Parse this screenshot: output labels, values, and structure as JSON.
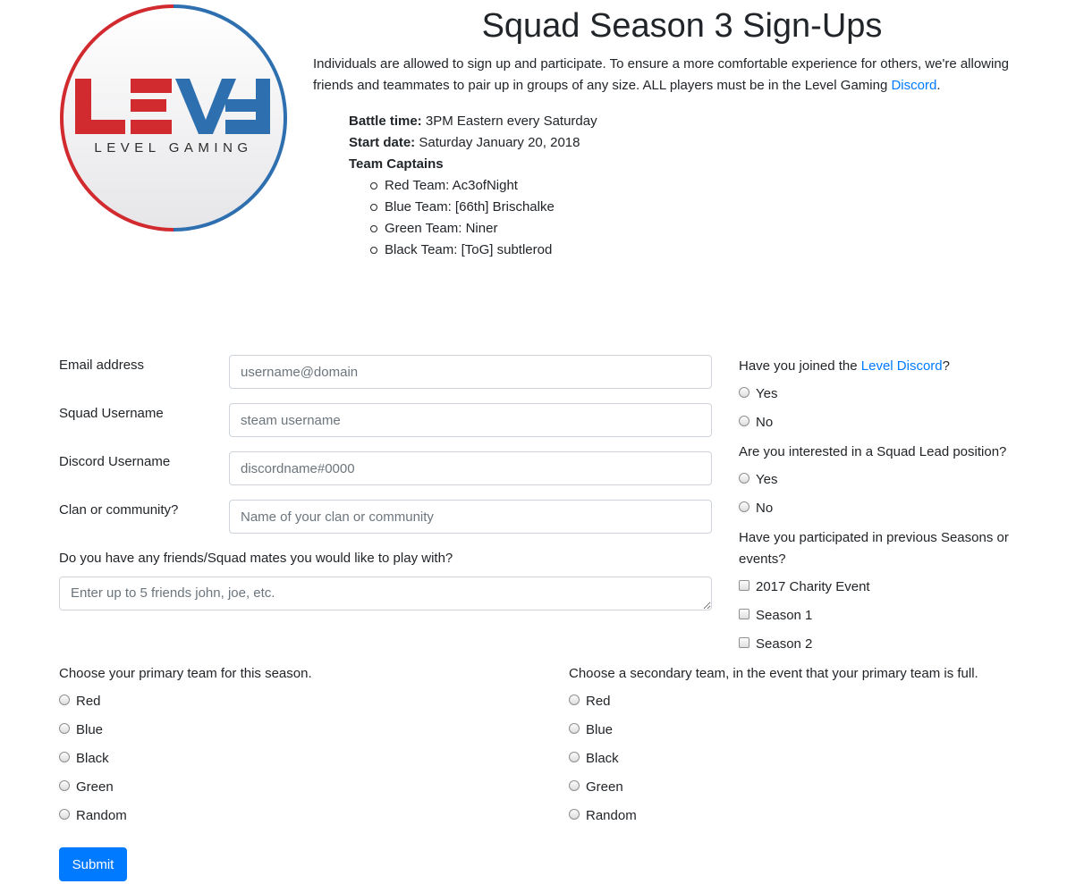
{
  "header": {
    "title": "Squad Season 3 Sign-Ups",
    "logo_text": "LEVEL GAMING",
    "intro_text": "Individuals are allowed to sign up and participate. To ensure a more comfortable experience for others, we're allowing friends and teammates to pair up in groups of any size. ALL players must be in the Level Gaming ",
    "intro_link": "Discord",
    "intro_end": "."
  },
  "details": {
    "battle_time_label": "Battle time:",
    "battle_time_value": " 3PM Eastern every Saturday",
    "start_date_label": "Start date:",
    "start_date_value": " Saturday January 20, 2018",
    "captains_label": "Team Captains",
    "captains": [
      "Red Team: Ac3ofNight",
      "Blue Team: [66th] Brischalke",
      "Green Team: Niner",
      "Black Team: [ToG] subtlerod"
    ]
  },
  "form": {
    "email_label": "Email address",
    "email_placeholder": "username@domain",
    "squad_label": "Squad Username",
    "squad_placeholder": "steam username",
    "discord_label": "Discord Username",
    "discord_placeholder": "discordname#0000",
    "clan_label": "Clan or community?",
    "clan_placeholder": "Name of your clan or community",
    "friends_label": "Do you have any friends/Squad mates you would like to play with?",
    "friends_placeholder": "Enter up to 5 friends john, joe, etc.",
    "discord_q_pre": "Have you joined the ",
    "discord_q_link": "Level Discord",
    "discord_q_post": "?",
    "yes": "Yes",
    "no": "No",
    "lead_q": "Are you interested in a Squad Lead position?",
    "prev_q": "Have you participated in previous Seasons or events?",
    "prev_options": [
      "2017 Charity Event",
      "Season 1",
      "Season 2"
    ],
    "primary_q": "Choose your primary team for this season.",
    "secondary_q": "Choose a secondary team, in the event that your primary team is full.",
    "teams": [
      "Red",
      "Blue",
      "Black",
      "Green",
      "Random"
    ],
    "submit": "Submit"
  },
  "colors": {
    "accent": "#007bff",
    "logo_red": "#d12a2f",
    "logo_blue": "#2e6fb0"
  }
}
